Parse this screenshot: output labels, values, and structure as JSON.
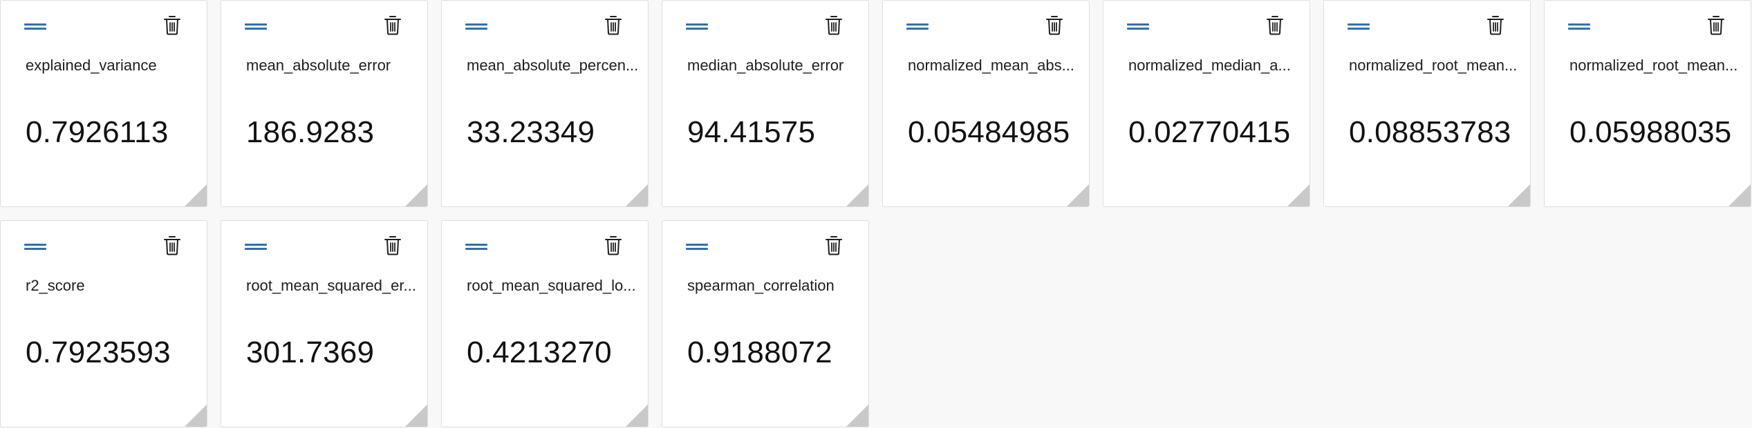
{
  "cards": [
    {
      "name": "explained_variance",
      "value": "0.7926113"
    },
    {
      "name": "mean_absolute_error",
      "value": "186.9283"
    },
    {
      "name": "mean_absolute_percen...",
      "value": "33.23349"
    },
    {
      "name": "median_absolute_error",
      "value": "94.41575"
    },
    {
      "name": "normalized_mean_abs...",
      "value": "0.05484985"
    },
    {
      "name": "normalized_median_a...",
      "value": "0.02770415"
    },
    {
      "name": "normalized_root_mean...",
      "value": "0.08853783"
    },
    {
      "name": "normalized_root_mean...",
      "value": "0.05988035"
    },
    {
      "name": "r2_score",
      "value": "0.7923593"
    },
    {
      "name": "root_mean_squared_er...",
      "value": "301.7369"
    },
    {
      "name": "root_mean_squared_lo...",
      "value": "0.4213270"
    },
    {
      "name": "spearman_correlation",
      "value": "0.9188072"
    }
  ],
  "icons": {
    "drag": "drag-handle-icon",
    "delete": "trash-icon",
    "resize": "resize-grip-icon"
  },
  "colors": {
    "accent": "#2f6fb9",
    "card_background": "#ffffff",
    "page_background": "#f8f8f8",
    "card_border": "#dedede"
  }
}
